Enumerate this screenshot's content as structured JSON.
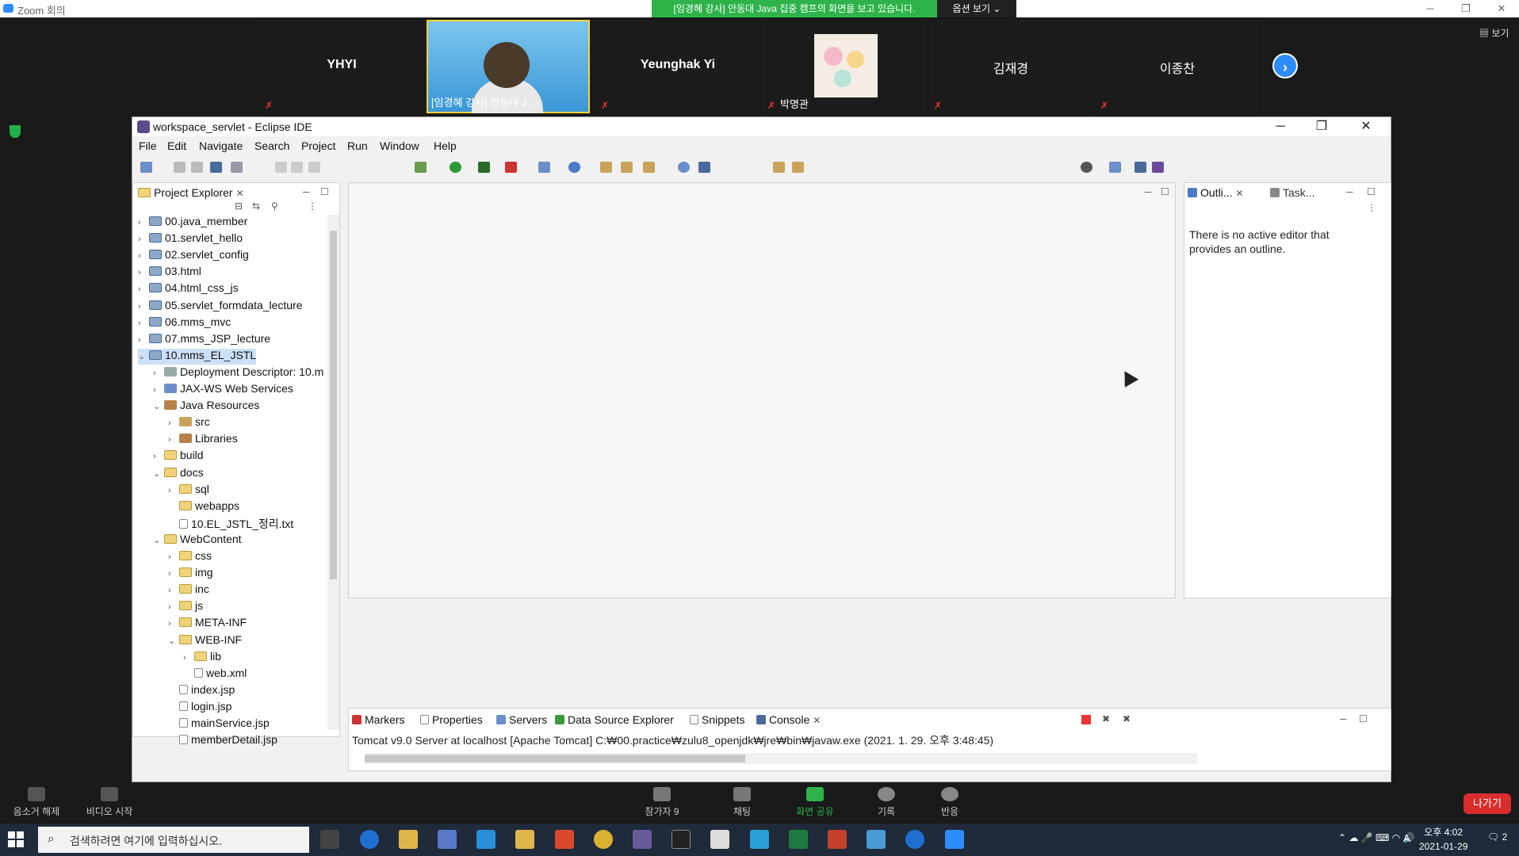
{
  "zoom": {
    "window_title": "Zoom 회의",
    "share_banner": "[임경혜 강사] 안동대 Java 집중 캠프의 화면을 보고 있습니다.",
    "view_options": "옵션 보기 ⌄",
    "view_label": "보기",
    "next_arrow": "›",
    "participants": [
      {
        "name": "YHYI",
        "muted": true
      },
      {
        "name": "[임경혜 강사] 안동대 J...",
        "muted": false,
        "video": true
      },
      {
        "name": "Yeunghak Yi",
        "muted": true
      },
      {
        "name": "박명관",
        "muted": true,
        "avatar": true
      },
      {
        "name": "김재경",
        "muted": true
      },
      {
        "name": "이종찬",
        "muted": true
      }
    ],
    "bottom_bar": {
      "unmute": "음소거 해제",
      "start_video": "비디오 시작",
      "participants": "참가자",
      "participants_count": "9",
      "chat": "채팅",
      "share_screen": "화면 공유",
      "record": "기록",
      "reactions": "반응",
      "leave": "나가기",
      "colors": {
        "share": "#2db34a",
        "leave": "#d92d2d"
      }
    }
  },
  "eclipse": {
    "title": "workspace_servlet - Eclipse IDE",
    "menu": [
      "File",
      "Edit",
      "Navigate",
      "Search",
      "Project",
      "Run",
      "Window",
      "Help"
    ],
    "project_explorer": {
      "tab": "Project Explorer",
      "items": [
        {
          "label": "00.java_member",
          "icon": "project-icon",
          "expanded": false
        },
        {
          "label": "01.servlet_hello",
          "icon": "project-icon",
          "expanded": false
        },
        {
          "label": "02.servlet_config",
          "icon": "project-icon",
          "expanded": false
        },
        {
          "label": "03.html",
          "icon": "project-icon",
          "expanded": false
        },
        {
          "label": "04.html_css_js",
          "icon": "project-icon",
          "expanded": false
        },
        {
          "label": "05.servlet_formdata_lecture",
          "icon": "project-icon",
          "expanded": false
        },
        {
          "label": "06.mms_mvc",
          "icon": "project-icon",
          "expanded": false
        },
        {
          "label": "07.mms_JSP_lecture",
          "icon": "project-icon",
          "expanded": false
        },
        {
          "label": "10.mms_EL_JSTL",
          "icon": "project-icon",
          "expanded": true,
          "selected": true
        },
        {
          "label": "Deployment Descriptor: 10.m",
          "icon": "descriptor-icon",
          "expanded": false
        },
        {
          "label": "JAX-WS Web Services",
          "icon": "webservice-icon",
          "expanded": false
        },
        {
          "label": "Java Resources",
          "icon": "java-resources-icon",
          "expanded": true
        },
        {
          "label": "src",
          "icon": "package-icon",
          "expanded": false
        },
        {
          "label": "Libraries",
          "icon": "library-icon",
          "expanded": false
        },
        {
          "label": "build",
          "icon": "folder-icon",
          "expanded": false
        },
        {
          "label": "docs",
          "icon": "folder-icon",
          "expanded": true
        },
        {
          "label": "sql",
          "icon": "folder-icon",
          "expanded": false
        },
        {
          "label": "webapps",
          "icon": "folder-icon",
          "expanded": null
        },
        {
          "label": "10.EL_JSTL_정리.txt",
          "icon": "file-icon",
          "expanded": null
        },
        {
          "label": "WebContent",
          "icon": "folder-icon",
          "expanded": true
        },
        {
          "label": "css",
          "icon": "folder-icon",
          "expanded": false
        },
        {
          "label": "img",
          "icon": "folder-icon",
          "expanded": false
        },
        {
          "label": "inc",
          "icon": "folder-icon",
          "expanded": false
        },
        {
          "label": "js",
          "icon": "folder-icon",
          "expanded": false
        },
        {
          "label": "META-INF",
          "icon": "folder-icon",
          "expanded": false
        },
        {
          "label": "WEB-INF",
          "icon": "folder-icon",
          "expanded": true
        },
        {
          "label": "lib",
          "icon": "folder-icon",
          "expanded": false
        },
        {
          "label": "web.xml",
          "icon": "xml-file-icon",
          "expanded": null
        },
        {
          "label": "index.jsp",
          "icon": "file-icon",
          "expanded": null
        },
        {
          "label": "login.jsp",
          "icon": "file-icon",
          "expanded": null
        },
        {
          "label": "mainService.jsp",
          "icon": "file-icon",
          "expanded": null
        },
        {
          "label": "memberDetail.jsp",
          "icon": "file-icon",
          "expanded": null
        }
      ]
    },
    "outline": {
      "tab_outline": "Outli...",
      "tab_tasks": "Task...",
      "message": "There is no active editor that provides an outline."
    },
    "bottom_tabs": [
      "Markers",
      "Properties",
      "Servers",
      "Data Source Explorer",
      "Snippets",
      "Console"
    ],
    "console_line": "Tomcat v9.0 Server at localhost [Apache Tomcat] C:₩00.practice₩zulu8_openjdk₩jre₩bin₩javaw.exe  (2021. 1. 29. 오후 3:48:45)"
  },
  "taskbar": {
    "search_placeholder": "검색하려면 여기에 입력하십시오.",
    "time": "오후 4:02",
    "date": "2021-01-29",
    "ime": "A",
    "notifications": "2"
  }
}
